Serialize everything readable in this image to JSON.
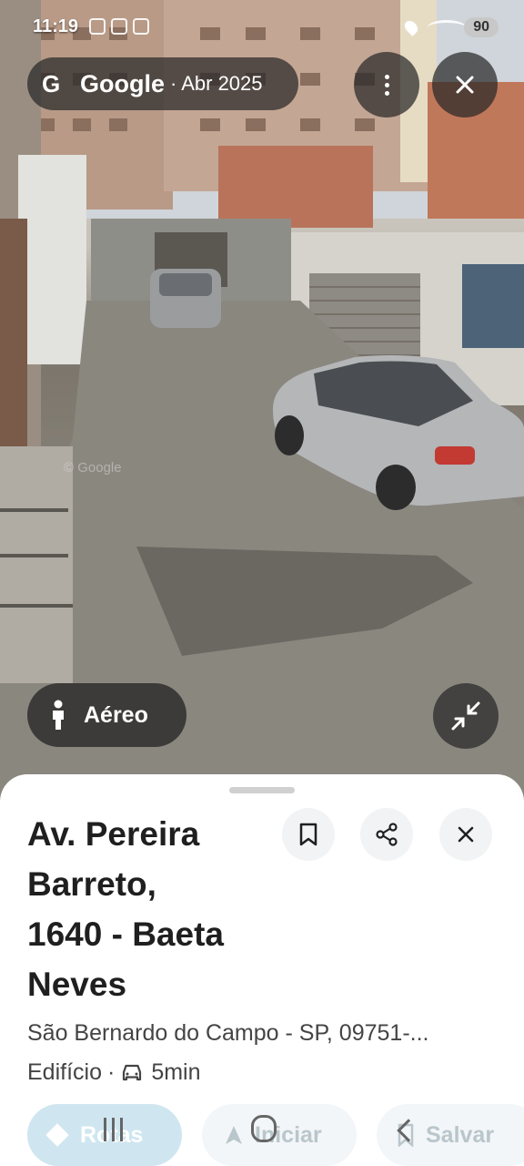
{
  "status_bar": {
    "time": "11:19",
    "battery": "90"
  },
  "top_bar": {
    "logo": "G",
    "brand": "Google",
    "date": "· Abr 2025",
    "icons": [
      "more-vert-icon",
      "close-icon"
    ]
  },
  "overlay": {
    "aerial_label": "Aéreo",
    "aerial_icon": "person-icon",
    "minimize_icon": "minimize-icon",
    "watermark": "© Google"
  },
  "place": {
    "title_line1": "Av. Pereira",
    "title_line2": "Barreto,",
    "title_line3": "1640 - Baeta",
    "title_line4": "Neves",
    "address": "São Bernardo do Campo - SP, 09751-...",
    "category": "Edifício",
    "separator": "·",
    "drive_time": "5min",
    "drive_icon": "car-icon"
  },
  "actions": {
    "save_icon": "bookmark-icon",
    "share_icon": "share-icon",
    "close_icon": "close-icon"
  },
  "buttons": {
    "routes": "Rotas",
    "start": "Iniciar",
    "save": "Salvar"
  },
  "colors": {
    "sheet_bg": "#ffffff",
    "overlay_bg": "#282828",
    "primary_button": "#cfe6f0"
  }
}
